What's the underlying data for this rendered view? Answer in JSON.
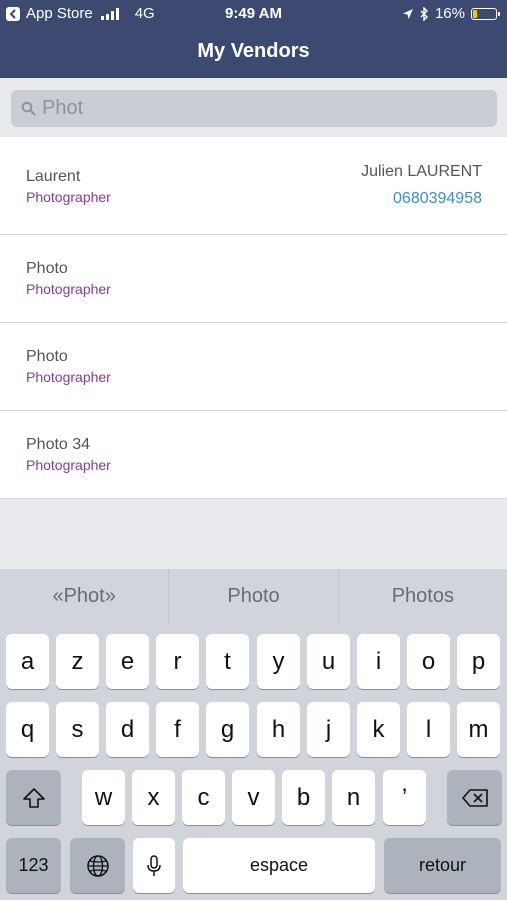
{
  "status_bar": {
    "back_app": "App Store",
    "network": "4G",
    "time": "9:49 AM",
    "battery": "16%",
    "battery_level": 0.16
  },
  "nav": {
    "title": "My Vendors"
  },
  "search": {
    "value": "Phot"
  },
  "vendors": [
    {
      "name": "Laurent",
      "category": "Photographer",
      "contact": "Julien LAURENT",
      "phone": "0680394958"
    },
    {
      "name": "Photo",
      "category": "Photographer"
    },
    {
      "name": "Photo",
      "category": "Photographer"
    },
    {
      "name": "Photo 34",
      "category": "Photographer"
    }
  ],
  "keyboard": {
    "suggestions": [
      "«Phot»",
      "Photo",
      "Photos"
    ],
    "row1": [
      "a",
      "z",
      "e",
      "r",
      "t",
      "y",
      "u",
      "i",
      "o",
      "p"
    ],
    "row2": [
      "q",
      "s",
      "d",
      "f",
      "g",
      "h",
      "j",
      "k",
      "l",
      "m"
    ],
    "row3": [
      "w",
      "x",
      "c",
      "v",
      "b",
      "n",
      "’"
    ],
    "numbers_key": "123",
    "space_key": "espace",
    "return_key": "retour"
  },
  "colors": {
    "header": "#3c4a72",
    "category": "#8b3a98",
    "phone": "#3f8ec8",
    "battery": "#f5c400"
  }
}
